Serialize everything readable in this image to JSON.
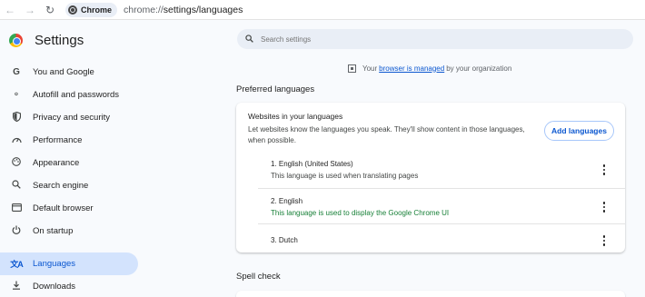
{
  "browser": {
    "chip_label": "Chrome",
    "url_scheme": "chrome://",
    "url_path": "settings/languages",
    "icons": {
      "back": "back-arrow-icon",
      "forward": "forward-arrow-icon",
      "reload": "reload-icon"
    }
  },
  "sidebar": {
    "title": "Settings",
    "items": [
      {
        "label": "You and Google",
        "icon": "google-icon",
        "active": false
      },
      {
        "label": "Autofill and passwords",
        "icon": "key-icon",
        "active": false
      },
      {
        "label": "Privacy and security",
        "icon": "shield-icon",
        "active": false
      },
      {
        "label": "Performance",
        "icon": "speedometer-icon",
        "active": false
      },
      {
        "label": "Appearance",
        "icon": "palette-icon",
        "active": false
      },
      {
        "label": "Search engine",
        "icon": "search-icon",
        "active": false
      },
      {
        "label": "Default browser",
        "icon": "browser-window-icon",
        "active": false
      },
      {
        "label": "On startup",
        "icon": "power-icon",
        "active": false
      },
      {
        "label": "Languages",
        "icon": "translate-icon",
        "active": true
      },
      {
        "label": "Downloads",
        "icon": "download-icon",
        "active": false
      }
    ]
  },
  "search": {
    "placeholder": "Search settings"
  },
  "managed": {
    "prefix": "Your",
    "link": "browser is managed",
    "suffix": "by your organization"
  },
  "preferred": {
    "section_title": "Preferred languages",
    "card_heading": "Websites in your languages",
    "card_description": "Let websites know the languages you speak. They'll show content in those languages, when possible.",
    "add_button": "Add languages",
    "languages": [
      {
        "name": "1. English (United States)",
        "note": "This language is used when translating pages",
        "note_color": "#444746"
      },
      {
        "name": "2. English",
        "note": "This language is used to display the Google Chrome UI",
        "note_color": "#188038"
      },
      {
        "name": "3. Dutch",
        "note": ""
      }
    ]
  },
  "spell_check": {
    "section_title": "Spell check"
  },
  "colors": {
    "accent": "#0b57d0",
    "active_nav_bg": "#d3e3fd",
    "green_note": "#188038",
    "page_bg": "#f8fafd"
  }
}
